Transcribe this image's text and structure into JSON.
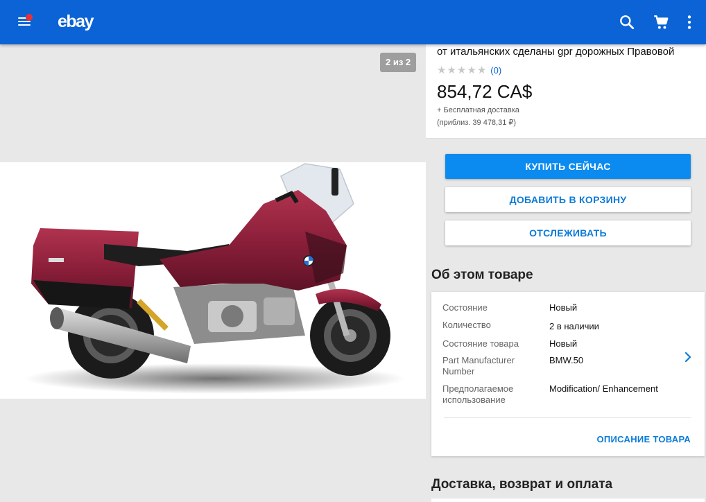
{
  "app_bar": {
    "logo": "ebay",
    "icons": [
      "menu-icon",
      "search-icon",
      "cart-icon",
      "more-vert-icon"
    ],
    "accent": "#0b63d6",
    "notification_dot_color": "#e53238"
  },
  "gallery": {
    "counter": "2 из 2",
    "image": "red-touring-motorcycle"
  },
  "listing": {
    "title": "от итальянских сделаны gpr дорожных Правовой",
    "rating_count": "(0)",
    "price": "854,72 CA$",
    "shipping": "+ Бесплатная доставка",
    "approx_price": "(приблиз. 39 478,31 ₽)"
  },
  "actions": {
    "buy_now": "КУПИТЬ СЕЙЧАС",
    "add_to_cart": "ДОБАВИТЬ В КОРЗИНУ",
    "watch": "ОТСЛЕЖИВАТЬ",
    "primary_color": "#0b8bf0"
  },
  "about": {
    "heading": "Об этом товаре",
    "specs": [
      {
        "label": "Состояние",
        "value": "Новый"
      },
      {
        "label": "Количество",
        "value": "2 в наличии"
      },
      {
        "label": "Состояние товара",
        "value": "Новый"
      },
      {
        "label": "Part Manufacturer Number",
        "value": "BMW.50"
      },
      {
        "label": "Предполагаемое использование",
        "value": "Modification/ Enhancement"
      }
    ],
    "description_link": "ОПИСАНИЕ ТОВАРА"
  },
  "delivery": {
    "heading": "Доставка, возврат и оплата"
  }
}
